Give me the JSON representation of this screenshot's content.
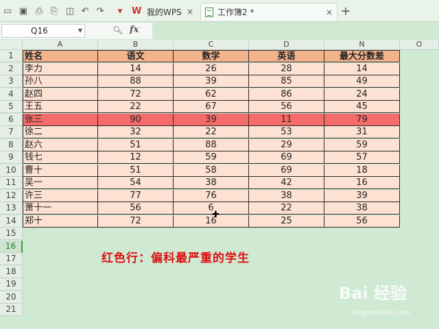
{
  "toolbar": {
    "tabs": [
      {
        "label": "我的WPS",
        "icon": "wps-logo-icon"
      },
      {
        "label": "工作簿2 *",
        "icon": "spreadsheet-icon"
      }
    ],
    "close_glyph": "×",
    "add_tab_glyph": "+"
  },
  "formula_bar": {
    "name_box": "Q16",
    "fx_label": "fx",
    "formula": ""
  },
  "sheet": {
    "columns": [
      "A",
      "B",
      "C",
      "D",
      "N",
      "O"
    ],
    "row_numbers": [
      "1",
      "2",
      "3",
      "4",
      "5",
      "6",
      "7",
      "8",
      "9",
      "10",
      "11",
      "12",
      "13",
      "14",
      "15",
      "16",
      "17",
      "18",
      "19",
      "20",
      "21"
    ],
    "selected_row": "16",
    "header": [
      "姓名",
      "语文",
      "数学",
      "英语",
      "最大分数差"
    ],
    "rows": [
      [
        "李力",
        "14",
        "26",
        "28",
        "14"
      ],
      [
        "孙八",
        "88",
        "39",
        "85",
        "49"
      ],
      [
        "赵四",
        "72",
        "62",
        "86",
        "24"
      ],
      [
        "王五",
        "22",
        "67",
        "56",
        "45"
      ],
      [
        "张三",
        "90",
        "39",
        "11",
        "79"
      ],
      [
        "徐二",
        "32",
        "22",
        "53",
        "31"
      ],
      [
        "赵六",
        "51",
        "88",
        "29",
        "59"
      ],
      [
        "钱七",
        "12",
        "59",
        "69",
        "57"
      ],
      [
        "曹十",
        "51",
        "58",
        "69",
        "18"
      ],
      [
        "吴一",
        "54",
        "38",
        "42",
        "16"
      ],
      [
        "许三",
        "77",
        "76",
        "38",
        "39"
      ],
      [
        "萧十一",
        "56",
        "6",
        "22",
        "38"
      ],
      [
        "郑十",
        "72",
        "16",
        "25",
        "56"
      ]
    ],
    "highlighted_row_index": 4,
    "highlight_color": "#f56b6b",
    "header_color": "#f3b48c",
    "body_color": "#fde1d2"
  },
  "annotation": "红色行：偏科最严重的学生",
  "watermark": {
    "main": "Bai 经验",
    "sub": "jingyan.baidu.com"
  }
}
